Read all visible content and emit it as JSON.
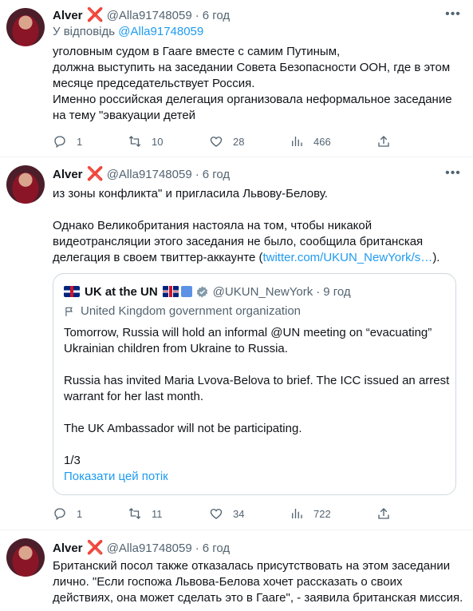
{
  "tweets": [
    {
      "author_name": "Alver",
      "badge": "❌",
      "handle": "@Alla91748059",
      "time": "6 год",
      "reply_prefix": "У відповідь",
      "reply_handle": "@Alla91748059",
      "lines": [
        "уголовным судом в Гааге вместе с самим  Путиным,",
        "должна выступить на заседании Совета Безопасности ООН, где в этом",
        "месяце председательствует Россия.",
        "Именно российская делегация организовала неформальное заседание",
        "на тему \"эвакуации детей"
      ],
      "stats": {
        "replies": "1",
        "retweets": "10",
        "likes": "28",
        "views": "466"
      }
    },
    {
      "author_name": "Alver",
      "badge": "❌",
      "handle": "@Alla91748059",
      "time": "6 год",
      "lines": [
        "из зоны конфликта\" и пригласила Львову-Белову.",
        "",
        "Однако Великобритания настояла на том, чтобы никакой",
        "видеотрансляции этого заседания не было, сообщила британская"
      ],
      "last_line_prefix": "делегация в своем твиттер-аккаунте (",
      "link_text": "twitter.com/UKUN_NewYork/s…",
      "last_line_suffix": ").",
      "quote": {
        "name": "UK at the UN",
        "handle": "@UKUN_NewYork",
        "time": "9 год",
        "org_label": "United Kingdom government organization",
        "lines": [
          "Tomorrow, Russia will hold an informal @UN meeting on “evacuating”",
          "Ukrainian children from Ukraine to Russia.",
          "",
          "Russia has invited Maria Lvova-Belova to brief. The ICC issued an arrest",
          "warrant for her last month.",
          "",
          "The UK Ambassador will not be participating.",
          "",
          "1/3"
        ],
        "show_thread": "Показати цей потік"
      },
      "stats": {
        "replies": "1",
        "retweets": "11",
        "likes": "34",
        "views": "722"
      }
    },
    {
      "author_name": "Alver",
      "badge": "❌",
      "handle": "@Alla91748059",
      "time": "6 год",
      "lines": [
        "Британский посол также отказалась присутствовать на этом заседании",
        "лично. \"Если госпожа Львова-Белова хочет рассказать о своих",
        "действиях, она может сделать это в Гааге\", - заявила британская миссия."
      ]
    }
  ],
  "dot": "·",
  "colors": {
    "link": "#1d9bf0",
    "secondary": "#536471",
    "badge": "#e0245e"
  }
}
